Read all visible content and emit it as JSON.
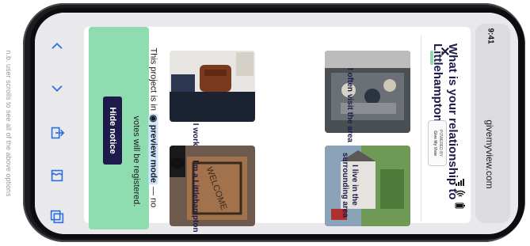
{
  "side_note": "n.b. user scrolls to see all of the above options",
  "status_bar": {
    "time": "9:41"
  },
  "browser": {
    "url": "givemyview.com"
  },
  "icons": {
    "toolbar": [
      "chevron-up-icon",
      "chevron-down-icon",
      "share-icon",
      "bookmarks-icon",
      "tabs-icon"
    ],
    "status": [
      "signal-icon",
      "wifi-icon",
      "battery-icon"
    ]
  },
  "page": {
    "badge": {
      "powered_by": "POWERED BY",
      "brand": "Give My View"
    },
    "question": "What is your relationship to Littlehampton?",
    "options": [
      {
        "label": "I often visit the area",
        "photo": "cafe-terrace-photo"
      },
      {
        "label": "I live in the surrounding area",
        "photo": "houses-street-photo"
      },
      {
        "label": "I work in",
        "photo": "commuter-bag-photo"
      },
      {
        "label": "I'm a Littlehampton",
        "photo": "welcome-mat-photo"
      }
    ]
  },
  "preview_notice": {
    "line1": "This project is in",
    "mode": "preview mode",
    "line1_tail": "— no",
    "line2": "votes will be registered.",
    "button": "Hide notice"
  },
  "colors": {
    "accent": "#8fdcb1",
    "navy": "#1d1b4a",
    "link": "#2f6fe0"
  }
}
